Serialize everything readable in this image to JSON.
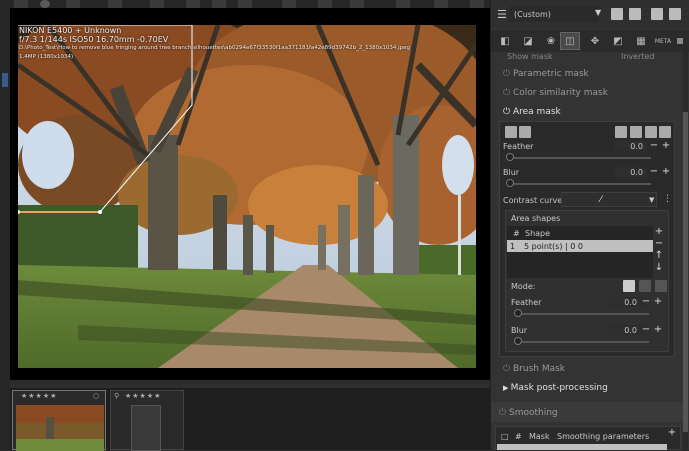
{
  "viewer": {
    "meta_line1": "NIKON E5400 + Unknown",
    "meta_line2": "f/7.3   1/144s   ISO50   16.70mm   -0.70EV",
    "meta_line3": "D:\\Photo_Test\\How to remove blue fringing around tree branch silhouettes\\ab0294e67f33530f1aa371181fa42e89d39742b_2_1380x1034.jpeg",
    "meta_line4": "1.4MP (1380x1034)"
  },
  "filmstrip": {
    "stars": "★★★★★"
  },
  "panel": {
    "profile_value": "(Custom)",
    "show_mask": "Show mask",
    "inverted": "Inverted",
    "parametric_mask": "Parametric mask",
    "color_similarity_mask": "Color similarity mask",
    "area_mask": "Area mask",
    "feather_label": "Feather",
    "feather_value": "0.0",
    "blur_label": "Blur",
    "blur_value": "0.0",
    "contrast_curve_label": "Contrast curve:",
    "area_shapes_label": "Area shapes",
    "col_hash": "#",
    "col_shape": "Shape",
    "shape_row_num": "1",
    "shape_row_value": "5 point(s) | 0 0",
    "mode_label": "Mode:",
    "feather2_label": "Feather",
    "feather2_value": "0.0",
    "blur2_label": "Blur",
    "blur2_value": "0.0",
    "brush_mask": "Brush Mask",
    "mask_post": "Mask post-processing",
    "smoothing": "Smoothing",
    "smooth_col_hash": "#",
    "smooth_col_mask": "Mask",
    "smooth_col_params": "Smoothing parameters"
  },
  "colors": {
    "accent": "#f0a060",
    "panel_bg": "#333333",
    "selected_row": "#c0c0c0"
  }
}
